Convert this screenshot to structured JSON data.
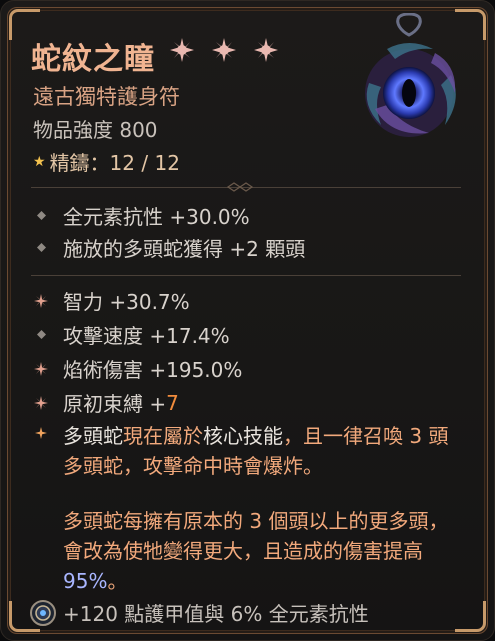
{
  "item": {
    "name": "蛇紋之瞳",
    "type": "遠古獨特護身符",
    "power": "物品強度 800",
    "masterwork_label": "精鑄：12 / 12",
    "stars": 3
  },
  "implicits": [
    {
      "text": "全元素抗性 +30.0%"
    },
    {
      "text": "施放的多頭蛇獲得 +2 顆頭"
    }
  ],
  "affixes": [
    {
      "label": "智力 +30.7%"
    },
    {
      "label": "攻擊速度 +17.4%"
    },
    {
      "label": "焰術傷害 +195.0%"
    },
    {
      "label_prefix": "原初束縛 +",
      "value": "7"
    }
  ],
  "unique_power": {
    "part1": "多頭蛇",
    "part2": "現在屬於",
    "part3": "核心技能",
    "part4": "，且一律召喚 3 頭多頭蛇，攻擊命中時會爆炸。"
  },
  "lore": {
    "text": "多頭蛇每擁有原本的 3 個頭以上的更多頭，會改為使牠變得更大，且造成的傷害提高 ",
    "value": "95%",
    "end": "。"
  },
  "socket_bonus": "+120 點護甲值與 6% 全元素抗性",
  "colors": {
    "title": "#f0b491",
    "accent": "#f28c3c",
    "value_blue": "#a9b6ff",
    "unique_text": "#f2a97c"
  }
}
